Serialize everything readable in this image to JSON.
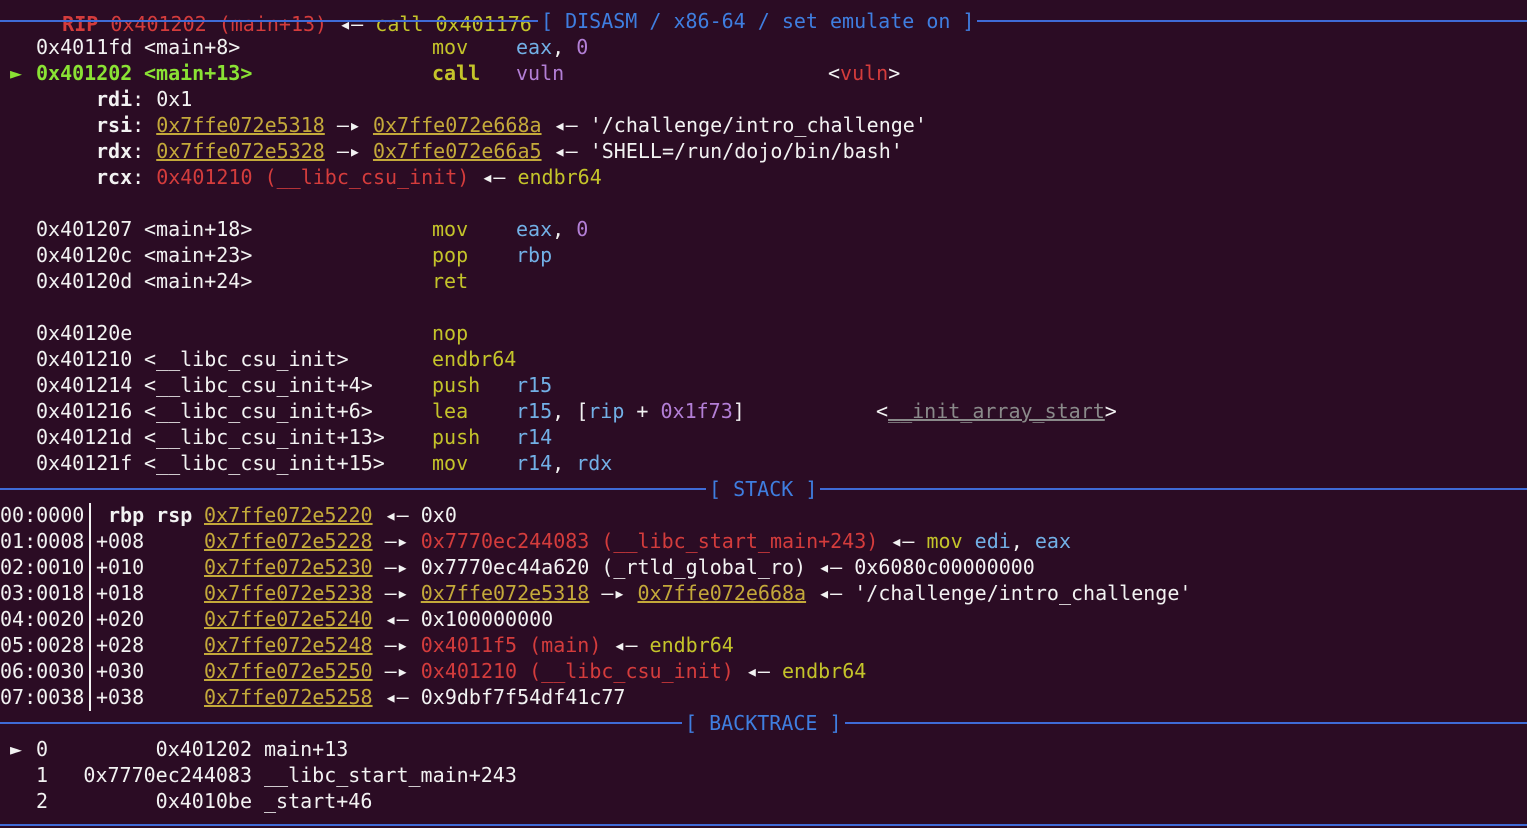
{
  "top_partial": {
    "reg": "RIP",
    "addr": "0x401202 (main+13)",
    "arrow": "◂—",
    "instr": "call 0x401176"
  },
  "headers": {
    "disasm": "[ DISASM / x86-64 / set emulate on ]",
    "stack": "[ STACK ]",
    "backtrace": "[ BACKTRACE ]"
  },
  "disasm": [
    {
      "marker": " ",
      "addr": "0x4011fd",
      "sym": "<main+8>",
      "mnem": "mov",
      "ops": [
        {
          "t": "eax",
          "c": "b"
        },
        {
          "t": ", ",
          "c": "w"
        },
        {
          "t": "0",
          "c": "m"
        }
      ]
    },
    {
      "marker": "►",
      "addr": "0x401202",
      "sym": "<main+13>",
      "mnem": "call",
      "current": true,
      "ops": [
        {
          "t": "vuln",
          "c": "m"
        }
      ],
      "comment_lt": "<",
      "comment_sym": "vuln",
      "comment_gt": ">"
    },
    {
      "marker": " ",
      "addr": "0x401207",
      "sym": "<main+18>",
      "mnem": "mov",
      "ops": [
        {
          "t": "eax",
          "c": "b"
        },
        {
          "t": ", ",
          "c": "w"
        },
        {
          "t": "0",
          "c": "m"
        }
      ]
    },
    {
      "marker": " ",
      "addr": "0x40120c",
      "sym": "<main+23>",
      "mnem": "pop",
      "ops": [
        {
          "t": "rbp",
          "c": "b"
        }
      ]
    },
    {
      "marker": " ",
      "addr": "0x40120d",
      "sym": "<main+24>",
      "mnem": "ret",
      "ops": []
    },
    {
      "marker": " ",
      "addr": "0x40120e",
      "sym": "",
      "mnem": "nop",
      "ops": []
    },
    {
      "marker": " ",
      "addr": "0x401210",
      "sym": "<__libc_csu_init>",
      "mnem": "endbr64",
      "ops": []
    },
    {
      "marker": " ",
      "addr": "0x401214",
      "sym": "<__libc_csu_init+4>",
      "mnem": "push",
      "ops": [
        {
          "t": "r15",
          "c": "b"
        }
      ]
    },
    {
      "marker": " ",
      "addr": "0x401216",
      "sym": "<__libc_csu_init+6>",
      "mnem": "lea",
      "ops": [
        {
          "t": "r15",
          "c": "b"
        },
        {
          "t": ", [",
          "c": "w"
        },
        {
          "t": "rip",
          "c": "b"
        },
        {
          "t": " + ",
          "c": "w"
        },
        {
          "t": "0x1f73",
          "c": "m"
        },
        {
          "t": "]",
          "c": "w"
        }
      ],
      "comment_lt": "<",
      "comment_sym": "__init_array_start",
      "comment_gt": ">"
    },
    {
      "marker": " ",
      "addr": "0x40121d",
      "sym": "<__libc_csu_init+13>",
      "mnem": "push",
      "ops": [
        {
          "t": "r14",
          "c": "b"
        }
      ]
    },
    {
      "marker": " ",
      "addr": "0x40121f",
      "sym": "<__libc_csu_init+15>",
      "mnem": "mov",
      "ops": [
        {
          "t": "r14",
          "c": "b"
        },
        {
          "t": ", ",
          "c": "w"
        },
        {
          "t": "rdx",
          "c": "b"
        }
      ]
    }
  ],
  "call_args": [
    {
      "reg": "rdi",
      "parts": [
        {
          "t": "0x1",
          "c": "w"
        }
      ]
    },
    {
      "reg": "rsi",
      "parts": [
        {
          "t": "0x7ffe072e5318",
          "c": "yu"
        },
        {
          "t": " —▸ ",
          "c": "w"
        },
        {
          "t": "0x7ffe072e668a",
          "c": "yu"
        },
        {
          "t": " ◂— ",
          "c": "w"
        },
        {
          "t": "'/challenge/intro_challenge'",
          "c": "w"
        }
      ]
    },
    {
      "reg": "rdx",
      "parts": [
        {
          "t": "0x7ffe072e5328",
          "c": "yu"
        },
        {
          "t": " —▸ ",
          "c": "w"
        },
        {
          "t": "0x7ffe072e66a5",
          "c": "yu"
        },
        {
          "t": " ◂— ",
          "c": "w"
        },
        {
          "t": "'SHELL=/run/dojo/bin/bash'",
          "c": "w"
        }
      ]
    },
    {
      "reg": "rcx",
      "parts": [
        {
          "t": "0x401210 (__libc_csu_init)",
          "c": "r"
        },
        {
          "t": " ◂— ",
          "c": "w"
        },
        {
          "t": "endbr64",
          "c": "y"
        }
      ]
    }
  ],
  "stack": [
    {
      "idx": "00:0000",
      "off": "rbp rsp",
      "off_bold": true,
      "addr": "0x7ffe072e5220",
      "parts": [
        {
          "t": " ◂— ",
          "c": "w"
        },
        {
          "t": "0x0",
          "c": "w"
        }
      ]
    },
    {
      "idx": "01:0008",
      "off": "+008",
      "addr": "0x7ffe072e5228",
      "parts": [
        {
          "t": " —▸ ",
          "c": "w"
        },
        {
          "t": "0x7770ec244083 (__libc_start_main+243)",
          "c": "r"
        },
        {
          "t": " ◂— ",
          "c": "w"
        },
        {
          "t": "mov ",
          "c": "y"
        },
        {
          "t": "edi",
          "c": "b"
        },
        {
          "t": ", ",
          "c": "w"
        },
        {
          "t": "eax",
          "c": "b"
        }
      ]
    },
    {
      "idx": "02:0010",
      "off": "+010",
      "addr": "0x7ffe072e5230",
      "parts": [
        {
          "t": " —▸ ",
          "c": "w"
        },
        {
          "t": "0x7770ec44a620 (_rtld_global_ro)",
          "c": "w"
        },
        {
          "t": " ◂— ",
          "c": "w"
        },
        {
          "t": "0x6080c00000000",
          "c": "w"
        }
      ]
    },
    {
      "idx": "03:0018",
      "off": "+018",
      "addr": "0x7ffe072e5238",
      "parts": [
        {
          "t": " —▸ ",
          "c": "w"
        },
        {
          "t": "0x7ffe072e5318",
          "c": "yu"
        },
        {
          "t": " —▸ ",
          "c": "w"
        },
        {
          "t": "0x7ffe072e668a",
          "c": "yu"
        },
        {
          "t": " ◂— ",
          "c": "w"
        },
        {
          "t": "'/challenge/intro_challenge'",
          "c": "w"
        }
      ]
    },
    {
      "idx": "04:0020",
      "off": "+020",
      "addr": "0x7ffe072e5240",
      "parts": [
        {
          "t": " ◂— ",
          "c": "w"
        },
        {
          "t": "0x100000000",
          "c": "w"
        }
      ]
    },
    {
      "idx": "05:0028",
      "off": "+028",
      "addr": "0x7ffe072e5248",
      "parts": [
        {
          "t": " —▸ ",
          "c": "w"
        },
        {
          "t": "0x4011f5 (main)",
          "c": "r"
        },
        {
          "t": " ◂— ",
          "c": "w"
        },
        {
          "t": "endbr64",
          "c": "y"
        }
      ]
    },
    {
      "idx": "06:0030",
      "off": "+030",
      "addr": "0x7ffe072e5250",
      "parts": [
        {
          "t": " —▸ ",
          "c": "w"
        },
        {
          "t": "0x401210 (__libc_csu_init)",
          "c": "r"
        },
        {
          "t": " ◂— ",
          "c": "w"
        },
        {
          "t": "endbr64",
          "c": "y"
        }
      ]
    },
    {
      "idx": "07:0038",
      "off": "+038",
      "addr": "0x7ffe072e5258",
      "parts": [
        {
          "t": " ◂— ",
          "c": "w"
        },
        {
          "t": "0x9dbf7f54df41c77",
          "c": "w"
        }
      ]
    }
  ],
  "backtrace": [
    {
      "marker": "►",
      "n": "0",
      "addr": "0x401202",
      "sym": "main+13"
    },
    {
      "marker": " ",
      "n": "1",
      "addr": "0x7770ec244083",
      "sym": "__libc_start_main+243"
    },
    {
      "marker": " ",
      "n": "2",
      "addr": "0x4010be",
      "sym": "_start+46"
    }
  ],
  "colors": {
    "background": "#2b0c24",
    "rule": "#3f6bd6",
    "text": "#f2f2f2",
    "current": "#8ae234",
    "mnemonic": "#c4c42a",
    "pointer": "#c4a93a",
    "code_addr": "#d43c3c",
    "register": "#72b0e6",
    "immediate": "#b37fd6"
  }
}
